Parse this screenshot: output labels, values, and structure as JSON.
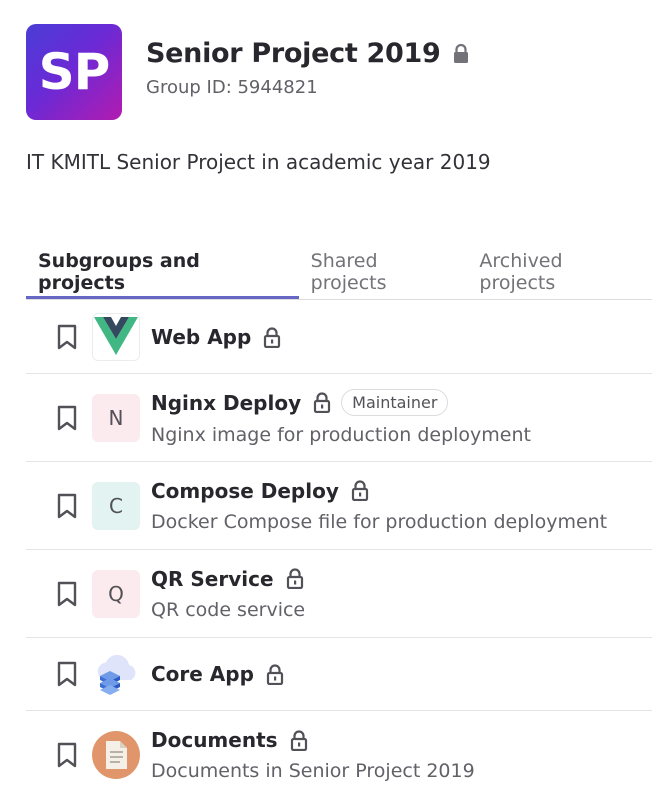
{
  "group": {
    "avatar_text": "SP",
    "name": "Senior Project 2019",
    "id_label": "Group ID: 5944821",
    "description": "IT KMITL Senior Project in academic year 2019"
  },
  "tabs": [
    {
      "label": "Subgroups and projects",
      "active": true
    },
    {
      "label": "Shared projects",
      "active": false
    },
    {
      "label": "Archived projects",
      "active": false
    }
  ],
  "projects": [
    {
      "name": "Web App",
      "description": "",
      "avatar": "vue-logo-icon",
      "avatar_text": "",
      "badge": ""
    },
    {
      "name": "Nginx Deploy",
      "description": "Nginx image for production deployment",
      "avatar_text": "N",
      "badge": "Maintainer"
    },
    {
      "name": "Compose Deploy",
      "description": "Docker Compose file for production deployment",
      "avatar_text": "C",
      "badge": ""
    },
    {
      "name": "QR Service",
      "description": "QR code service",
      "avatar_text": "Q",
      "badge": ""
    },
    {
      "name": "Core App",
      "description": "",
      "avatar": "cloud-server-icon",
      "avatar_text": "",
      "badge": ""
    },
    {
      "name": "Documents",
      "description": "Documents in Senior Project 2019",
      "avatar": "document-icon",
      "avatar_text": "",
      "badge": ""
    }
  ],
  "colors": {
    "accent": "#6666c4",
    "avatar_n_bg": "#fcebee",
    "avatar_c_bg": "#e2f3f1",
    "avatar_q_bg": "#fcebee"
  }
}
